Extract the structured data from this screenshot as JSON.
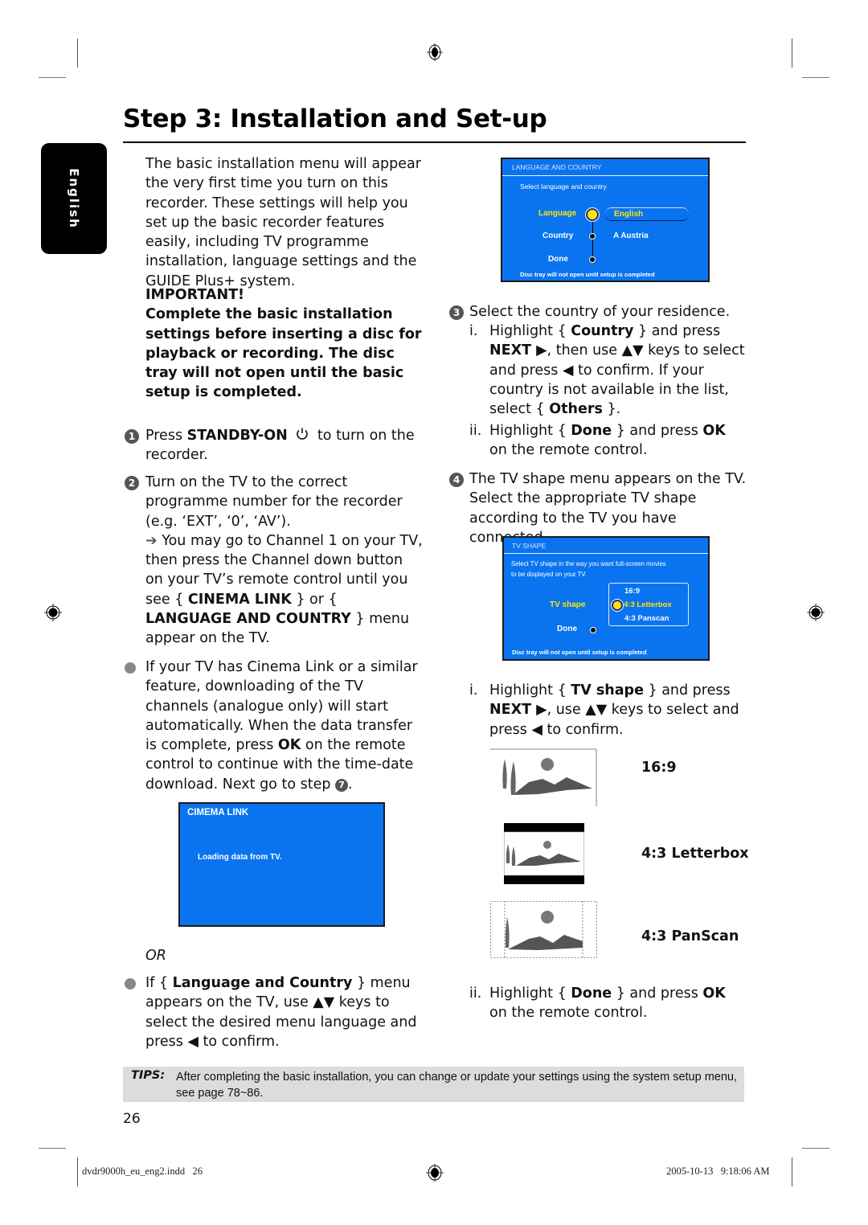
{
  "page": {
    "title": "Step 3: Installation and Set-up",
    "language_tab": "English",
    "page_number": "26"
  },
  "left_column": {
    "intro": "The basic installation menu will appear the very first time you turn on this recorder. These settings will help you set up the basic recorder features easily, including TV programme installation, language settings and the GUIDE Plus+ system.",
    "important_label": "IMPORTANT!",
    "important_text": "Complete the basic installation settings before inserting a disc for playback or recording. The disc tray will not open until the basic setup is completed.",
    "step1": {
      "number": "1",
      "pre": "Press ",
      "key": "STANDBY-ON",
      "icon": "power-icon",
      "post": " to turn on the recorder."
    },
    "step2": {
      "number": "2",
      "text": "Turn on the TV to the correct programme number for the recorder (e.g. ‘EXT’, ‘0’, ‘AV’).",
      "arrow": "➔",
      "note_pre": " You may go to Channel 1 on your TV, then press the Channel down button on your TV’s remote control until you see { ",
      "note_key1": "CINEMA LINK",
      "note_mid": " } or { ",
      "note_key2": "LANGUAGE AND COUNTRY",
      "note_post": " } menu appear on the TV."
    },
    "bullet1": {
      "pre": "If your TV has Cinema Link or a similar feature, downloading of the TV channels (analogue only) will start automatically. When the data transfer is complete, press ",
      "key": "OK",
      "mid": " on the remote control to continue with the time-date download. Next go to step ",
      "step_ref": "7",
      "post": "."
    },
    "or_label": "OR",
    "bullet2": {
      "pre": "If { ",
      "key": "Language and Country",
      "post": " } menu appears on the TV, use ▲▼ keys to select the desired menu language and press ◀ to confirm."
    }
  },
  "cinema_link_screen": {
    "header": "CIMEMA LINK",
    "message": "Loading data from TV."
  },
  "language_screen": {
    "header": "LANGUAGE AND COUNTRY",
    "subtitle": "Select language and country",
    "rows": [
      {
        "label": "Language",
        "value": "English",
        "selected": true
      },
      {
        "label": "Country",
        "value": "A Austria",
        "selected": false
      },
      {
        "label": "Done",
        "value": "",
        "selected": false
      }
    ],
    "footer": "Disc tray will not open until setup is completed"
  },
  "right_column": {
    "step3": {
      "number": "3",
      "text": "Select the country of your residence.",
      "i_label": "i.",
      "i_pre": "Highlight { ",
      "i_key": "Country",
      "i_mid": " } and press ",
      "i_next": "NEXT ▶",
      "i_post": ", then use ▲▼ keys to select and press ◀ to confirm. If your country is not available in the list, select { ",
      "i_others": "Others",
      "i_end": " }.",
      "ii_label": "ii.",
      "ii_pre": "Highlight { ",
      "ii_key": "Done",
      "ii_mid": " } and press ",
      "ii_ok": "OK",
      "ii_post": " on the remote control."
    },
    "step4": {
      "number": "4",
      "text": "The TV shape menu appears on the TV. Select the appropriate TV shape according to the TV you have connected.",
      "i_label": "i.",
      "i_pre": "Highlight { ",
      "i_key": "TV shape",
      "i_mid": " } and press ",
      "i_next": "NEXT ▶",
      "i_post": ", use ▲▼ keys to select and press ◀ to confirm.",
      "ii_label": "ii.",
      "ii_pre": "Highlight { ",
      "ii_key": "Done",
      "ii_mid": " } and press ",
      "ii_ok": "OK",
      "ii_post": " on the remote control."
    },
    "shapes": [
      {
        "label": "16:9",
        "illustration": "widescreen-landscape"
      },
      {
        "label": "4:3 Letterbox",
        "illustration": "letterbox-landscape"
      },
      {
        "label": "4:3 PanScan",
        "illustration": "panscan-landscape"
      }
    ]
  },
  "tv_shape_screen": {
    "header": "TV SHAPE",
    "subtitle_line1": "Select TV shape in the way you want full-screen movies",
    "subtitle_line2": "to be displayed on your TV.",
    "row_label": "TV shape",
    "options": [
      "16:9",
      "4:3 Letterbox",
      "4:3 Panscan"
    ],
    "selected_option": "4:3 Letterbox",
    "done_label": "Done",
    "footer": "Disc tray will not open until setup is completed"
  },
  "tips": {
    "label": "TIPS:",
    "text": "After completing the basic installation, you can change or update your settings using the system setup menu, see page 78~86."
  },
  "footer": {
    "file": "dvdr9000h_eu_eng2.indd   26",
    "timestamp": "2005-10-13   9:18:06 AM"
  }
}
